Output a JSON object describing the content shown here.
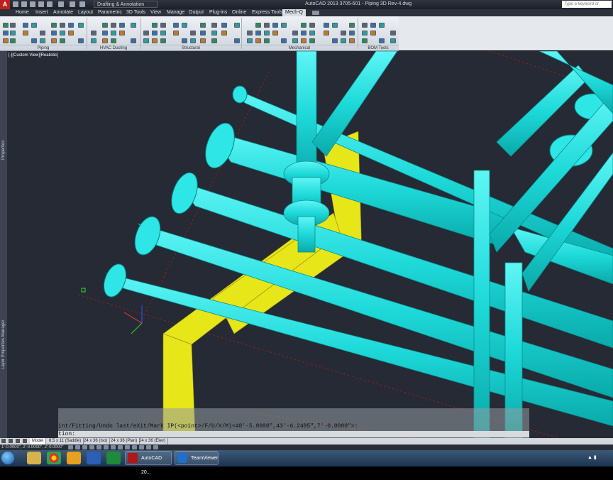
{
  "app": {
    "workspace": "Drafting & Annotation",
    "window_title": "AutoCAD 2013    3705-601 - Piping 3D Rev-4.dwg",
    "search_placeholder": "Type a keyword or phrase"
  },
  "menu_tabs": [
    "Home",
    "Insert",
    "Annotate",
    "Layout",
    "Parametric",
    "3D Tools",
    "View",
    "Manage",
    "Output",
    "Plug-ins",
    "Online",
    "Express Tools",
    "Mech-Q"
  ],
  "active_tab": "Mech-Q",
  "ribbon_groups": [
    "Piping",
    "HVAC Ducting",
    "Structural",
    "Mechanical",
    "BOM Tools"
  ],
  "viewport": {
    "label": "[-][Custom View][Realistic]",
    "side_labels": [
      "Properties",
      "Layer Properties Manager"
    ]
  },
  "command_line": {
    "history": "int/Fitting/Undo last/eXit/Mark IP(<point>/F/U/X/M)<48'-5.0000\",43'-6.2495\",7'-0.0000\">:",
    "prompt": "tion:"
  },
  "layout_tabs": [
    "Model",
    "8.5 x 11 (Saddle)",
    "24 x 36 (Iso)",
    "24 x 36 (Plan)",
    "24 x 36 (Elev)"
  ],
  "active_layout": "Model",
  "status": {
    "coordinates": "1'-0.0000\", 2'-0.0000\", 2'-0.0000\""
  },
  "taskbar": {
    "items": [
      "AutoCAD 20...",
      "TeamViewer"
    ]
  },
  "colors": {
    "pipe": "#2ee6e6",
    "steel": "#f0f020",
    "background": "#252a34",
    "app_red": "#c21f1f"
  }
}
